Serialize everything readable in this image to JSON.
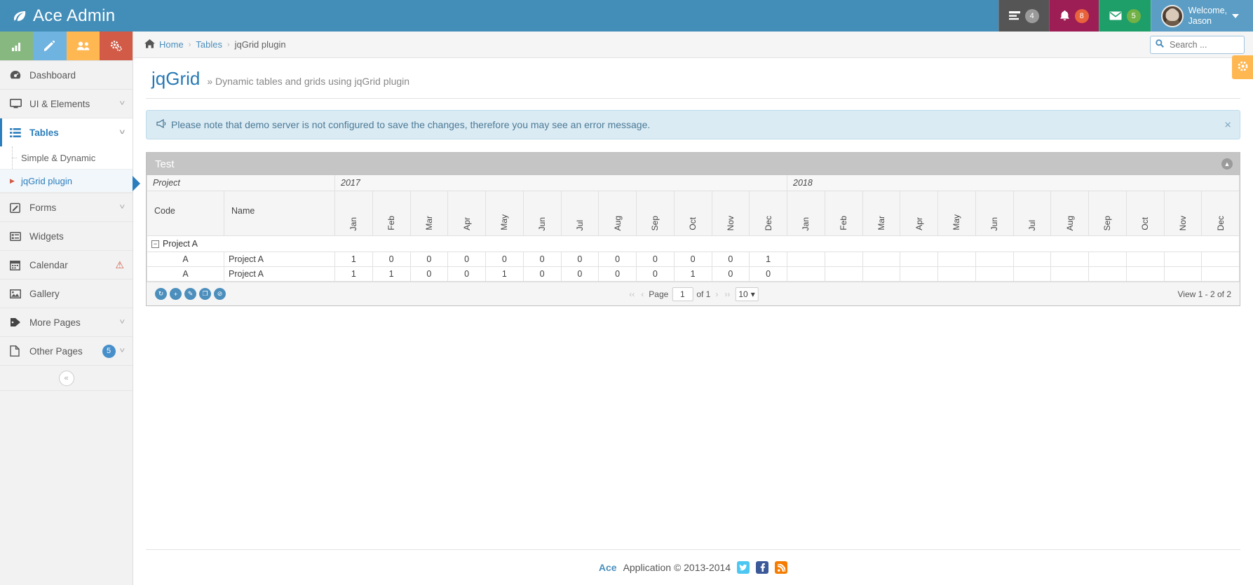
{
  "navbar": {
    "brand": "Ace Admin",
    "brand_icon": "leaf-icon",
    "tasks": {
      "icon": "tasks-icon",
      "count": "4"
    },
    "notifications": {
      "icon": "bell-icon",
      "count": "8"
    },
    "messages": {
      "icon": "envelope-icon",
      "count": "5"
    },
    "user": {
      "greeting": "Welcome,",
      "name": "Jason",
      "caret": "caret-down-icon"
    }
  },
  "sidebar": {
    "shortcuts": [
      {
        "name": "bar-chart-shortcut",
        "icon": "ᵜ"
      },
      {
        "name": "edit-shortcut",
        "icon": "✎"
      },
      {
        "name": "users-shortcut",
        "icon": "ᵜ"
      },
      {
        "name": "cogs-shortcut",
        "icon": "⚙"
      }
    ],
    "items": [
      {
        "label": "Dashboard",
        "icon": "dashboard-icon",
        "has_chevron": false
      },
      {
        "label": "UI & Elements",
        "icon": "desktop-icon",
        "has_chevron": true
      },
      {
        "label": "Tables",
        "icon": "list-icon",
        "has_chevron": true,
        "active": true
      },
      {
        "label": "Forms",
        "icon": "edit-icon",
        "has_chevron": true
      },
      {
        "label": "Widgets",
        "icon": "widgets-icon",
        "has_chevron": false
      },
      {
        "label": "Calendar",
        "icon": "calendar-icon",
        "has_chevron": false,
        "warning": true
      },
      {
        "label": "Gallery",
        "icon": "picture-icon",
        "has_chevron": false
      },
      {
        "label": "More Pages",
        "icon": "tag-icon",
        "has_chevron": true
      },
      {
        "label": "Other Pages",
        "icon": "file-icon",
        "has_chevron": true,
        "badge": "5"
      }
    ],
    "submenu": [
      {
        "label": "Simple & Dynamic",
        "current": false
      },
      {
        "label": "jqGrid plugin",
        "current": true
      }
    ],
    "collapse_label": "«"
  },
  "breadcrumb": {
    "home_icon": "home-icon",
    "items": [
      "Home",
      "Tables",
      "jqGrid plugin"
    ],
    "separator": "›"
  },
  "search": {
    "icon": "search-icon",
    "placeholder": "Search ...",
    "value": ""
  },
  "page": {
    "title": "jqGrid",
    "subtitle": "» Dynamic tables and grids using jqGrid plugin",
    "settings_icon": "gear-icon"
  },
  "alert": {
    "icon": "bullhorn-icon",
    "text": "Please note that demo server is not configured to save the changes, therefore you may see an error message.",
    "close": "×"
  },
  "grid": {
    "caption": "Test",
    "collapse_icon": "chevron-up-icon",
    "group_headers": [
      {
        "label": "Project",
        "span": 2
      },
      {
        "label": "2017",
        "span": 12
      },
      {
        "label": "2018",
        "span": 12
      }
    ],
    "columns": [
      "Code",
      "Name",
      "Jan",
      "Feb",
      "Mar",
      "Apr",
      "May",
      "Jun",
      "Jul",
      "Aug",
      "Sep",
      "Oct",
      "Nov",
      "Dec",
      "Jan",
      "Feb",
      "Mar",
      "Apr",
      "May",
      "Jun",
      "Jul",
      "Aug",
      "Sep",
      "Oct",
      "Nov",
      "Dec"
    ],
    "group_row": {
      "toggle": "−",
      "label": "Project A"
    },
    "rows": [
      {
        "code": "A",
        "name": "Project A",
        "values": [
          "1",
          "0",
          "0",
          "0",
          "0",
          "0",
          "0",
          "0",
          "0",
          "0",
          "0",
          "1",
          "",
          "",
          "",
          "",
          "",
          "",
          "",
          "",
          "",
          "",
          "",
          ""
        ]
      },
      {
        "code": "A",
        "name": "Project A",
        "values": [
          "1",
          "1",
          "0",
          "0",
          "1",
          "0",
          "0",
          "0",
          "0",
          "1",
          "0",
          "0",
          "",
          "",
          "",
          "",
          "",
          "",
          "",
          "",
          "",
          "",
          "",
          ""
        ]
      }
    ]
  },
  "pager": {
    "tools": [
      {
        "name": "refresh-button",
        "icon": "↻"
      },
      {
        "name": "add-button",
        "icon": "+"
      },
      {
        "name": "edit-button",
        "icon": "✎"
      },
      {
        "name": "copy-button",
        "icon": "❐"
      },
      {
        "name": "delete-button",
        "icon": "⊘"
      }
    ],
    "first": "‹‹",
    "prev": "‹",
    "page_label": "Page",
    "page_value": "1",
    "of_label": "of 1",
    "next": "›",
    "last": "››",
    "rows_per_page": "10",
    "rows_caret": "▾",
    "view_info": "View 1 - 2 of 2"
  },
  "footer": {
    "brand": "Ace",
    "text": "Application © 2013-2014",
    "social": [
      {
        "name": "twitter-icon",
        "glyph": "t"
      },
      {
        "name": "facebook-icon",
        "glyph": "f"
      },
      {
        "name": "rss-icon",
        "glyph": "◔"
      }
    ]
  }
}
